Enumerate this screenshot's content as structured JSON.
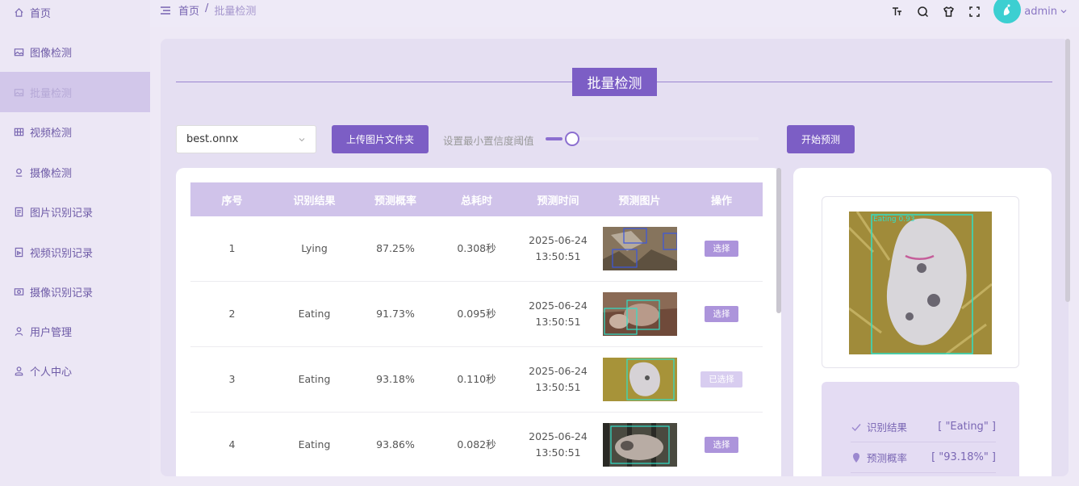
{
  "sidebar": {
    "items": [
      {
        "label": "首页",
        "icon": "home-icon"
      },
      {
        "label": "图像检测",
        "icon": "image-icon"
      },
      {
        "label": "批量检测",
        "icon": "images-icon"
      },
      {
        "label": "视频检测",
        "icon": "video-icon"
      },
      {
        "label": "摄像检测",
        "icon": "camera-icon"
      },
      {
        "label": "图片识别记录",
        "icon": "doc-icon"
      },
      {
        "label": "视频识别记录",
        "icon": "doc-video-icon"
      },
      {
        "label": "摄像识别记录",
        "icon": "camera-record-icon"
      },
      {
        "label": "用户管理",
        "icon": "user-icon"
      },
      {
        "label": "个人中心",
        "icon": "person-icon"
      }
    ],
    "active_index": 2
  },
  "header": {
    "breadcrumb": [
      "首页",
      "/",
      "批量检测"
    ],
    "user": "admin"
  },
  "main": {
    "title": "批量检测",
    "model_select": "best.onnx",
    "upload_label": "上传图片文件夹",
    "threshold_label": "设置最小置信度阈值",
    "threshold_value": 0.08,
    "start_label": "开始预测",
    "table": {
      "columns": [
        "序号",
        "识别结果",
        "预测概率",
        "总耗时",
        "预测时间",
        "预测图片",
        "操作"
      ],
      "rows": [
        {
          "index": "1",
          "result": "Lying",
          "prob": "87.25%",
          "time": "0.308秒",
          "date": "2025-06-24",
          "clock": "13:50:51",
          "action": "选择"
        },
        {
          "index": "2",
          "result": "Eating",
          "prob": "91.73%",
          "time": "0.095秒",
          "date": "2025-06-24",
          "clock": "13:50:51",
          "action": "选择"
        },
        {
          "index": "3",
          "result": "Eating",
          "prob": "93.18%",
          "time": "0.110秒",
          "date": "2025-06-24",
          "clock": "13:50:51",
          "action": "已选择"
        },
        {
          "index": "4",
          "result": "Eating",
          "prob": "93.86%",
          "time": "0.082秒",
          "date": "2025-06-24",
          "clock": "13:50:51",
          "action": "选择"
        }
      ]
    },
    "detail": {
      "result_label": "识别结果",
      "result_value": "[ \"Eating\" ]",
      "prob_label": "预测概率",
      "prob_value": "[ \"93.18%\" ]",
      "box_label": "Eating 0.93"
    }
  },
  "colors": {
    "accent": "#7c5ec5",
    "table_header": "#d0c3ea",
    "sidebar_active": "#d2c7ea"
  }
}
